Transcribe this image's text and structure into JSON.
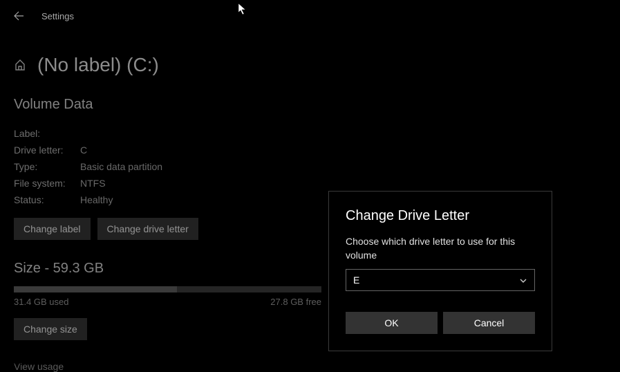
{
  "header": {
    "settings_label": "Settings"
  },
  "page": {
    "title": "(No label) (C:)"
  },
  "volume_data": {
    "heading": "Volume Data",
    "labels": {
      "label": "Label:",
      "drive_letter": "Drive letter:",
      "type": "Type:",
      "file_system": "File system:",
      "status": "Status:"
    },
    "values": {
      "label": "",
      "drive_letter": "C",
      "type": "Basic data partition",
      "file_system": "NTFS",
      "status": "Healthy"
    },
    "buttons": {
      "change_label": "Change label",
      "change_drive_letter": "Change drive letter"
    }
  },
  "size": {
    "heading": "Size - 59.3 GB",
    "used": "31.4 GB used",
    "free": "27.8 GB free",
    "change_size": "Change size",
    "view_usage": "View usage"
  },
  "dialog": {
    "title": "Change Drive Letter",
    "text": "Choose which drive letter to use for this volume",
    "selected": "E",
    "ok": "OK",
    "cancel": "Cancel"
  }
}
